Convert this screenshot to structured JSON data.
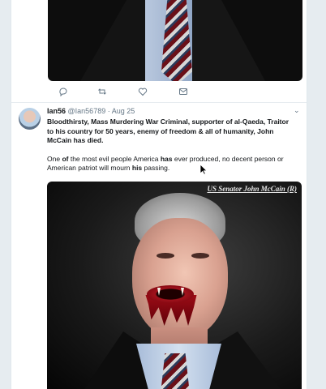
{
  "tweet": {
    "display_name": "Ian56",
    "handle": "@Ian56789",
    "separator": "·",
    "date": "Aug 25",
    "text_paragraph1": "Bloodthirsty, Mass Murdering War Criminal, supporter of al-Qaeda, Traitor to his country for 50 years, enemy of freedom & all of humanity, John McCain has died.",
    "text_p2_a": "One ",
    "text_p2_b": "of",
    "text_p2_c": " the most evil people America ",
    "text_p2_d": "has",
    "text_p2_e": " ever produced, no decent person or American patriot will mourn ",
    "text_p2_f": "his",
    "text_p2_g": " passing.",
    "caret_glyph": "⌄",
    "media_caption": "US Senator John McCain (R)"
  },
  "previous_tweet_actions": {
    "icons": [
      "reply-icon",
      "retweet-icon",
      "like-icon",
      "message-icon"
    ]
  },
  "colors": {
    "background": "#e6ecf0",
    "card": "#ffffff",
    "icon": "#657786",
    "text": "#14171a"
  }
}
